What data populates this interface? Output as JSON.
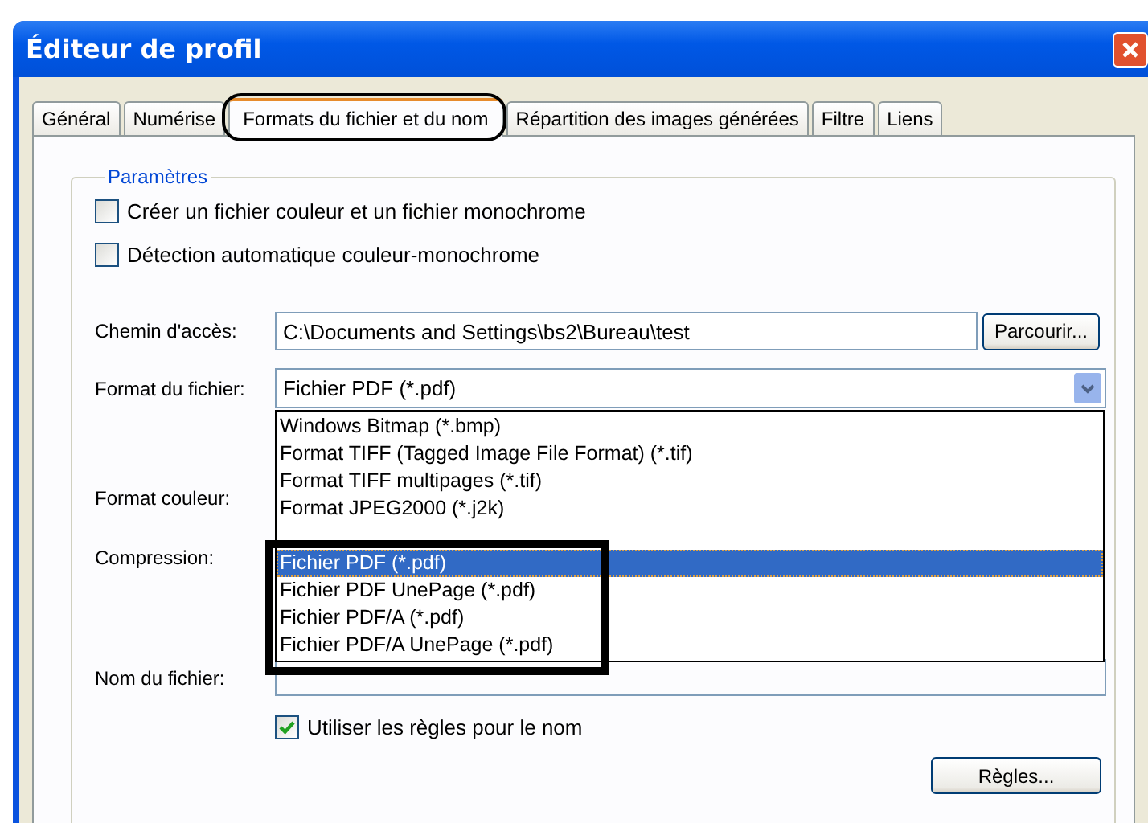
{
  "window": {
    "title": "Éditeur de profil"
  },
  "tabs": [
    {
      "label": "Général",
      "selected": false,
      "circled": false
    },
    {
      "label": "Numérise",
      "selected": false,
      "circled": false
    },
    {
      "label": "Formats du fichier et du nom",
      "selected": true,
      "circled": true
    },
    {
      "label": "Répartition des images générées",
      "selected": false,
      "circled": false
    },
    {
      "label": "Filtre",
      "selected": false,
      "circled": false
    },
    {
      "label": "Liens",
      "selected": false,
      "circled": false
    }
  ],
  "group": {
    "legend": "Paramètres",
    "checkboxes": [
      {
        "label": "Créer un fichier couleur et un fichier monochrome",
        "checked": false
      },
      {
        "label": "Détection automatique couleur-monochrome",
        "checked": false
      }
    ]
  },
  "form": {
    "path": {
      "label": "Chemin d'accès:",
      "value": "C:\\Documents and Settings\\bs2\\Bureau\\test",
      "button": "Parcourir..."
    },
    "file_format": {
      "label": "Format du fichier:",
      "value": "Fichier PDF (*.pdf)",
      "expanded": true,
      "options": [
        {
          "label": "Windows Bitmap (*.bmp)",
          "selected": false,
          "boxed": false
        },
        {
          "label": "Format TIFF (Tagged Image File Format) (*.tif)",
          "selected": false,
          "boxed": false
        },
        {
          "label": "Format TIFF multipages (*.tif)",
          "selected": false,
          "boxed": false
        },
        {
          "label": "Format JPEG2000 (*.j2k)",
          "selected": false,
          "boxed": false
        },
        {
          "label": "Fichier PDF (*.pdf)",
          "selected": true,
          "boxed": true
        },
        {
          "label": "Fichier PDF UnePage (*.pdf)",
          "selected": false,
          "boxed": true
        },
        {
          "label": "Fichier PDF/A (*.pdf)",
          "selected": false,
          "boxed": true
        },
        {
          "label": "Fichier PDF/A UnePage (*.pdf)",
          "selected": false,
          "boxed": true
        }
      ]
    },
    "color_format": {
      "label": "Format couleur:"
    },
    "compression": {
      "label": "Compression:"
    },
    "file_name": {
      "label": "Nom du fichier:"
    },
    "use_rules": {
      "label": "Utiliser les règles pour le nom",
      "checked": true
    },
    "rules_button": "Règles..."
  }
}
